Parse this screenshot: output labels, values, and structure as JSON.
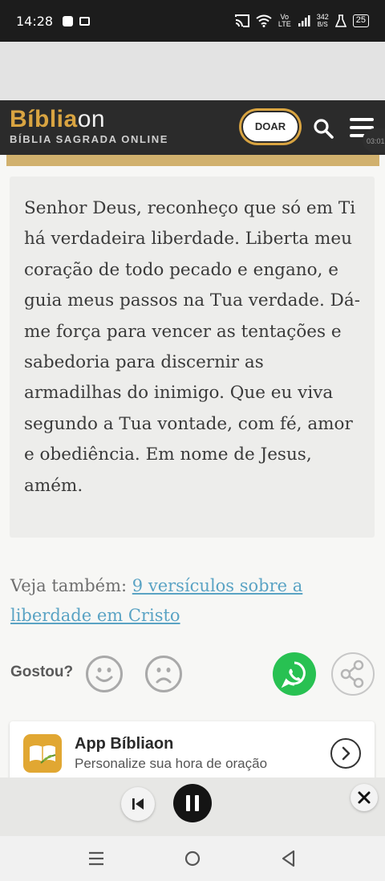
{
  "status_bar": {
    "time": "14:28",
    "network_vo": "Vo",
    "network_lte": "LTE",
    "speed_value": "342",
    "speed_unit": "B/S",
    "battery": "25"
  },
  "header": {
    "logo_main": "Bíblia",
    "logo_on": "on",
    "logo_subtitle": "BÍBLIA SAGRADA ONLINE",
    "donate_label": "DOAR",
    "timer_chip": "03:01"
  },
  "prayer": {
    "text": "Senhor Deus, reconheço que só em Ti há verdadeira liberdade. Liberta meu coração de todo pecado e engano, e guia meus passos na Tua verdade. Dá-me força para vencer as tentações e sabedoria para discernir as armadilhas do inimigo. Que eu viva segundo a Tua vontade, com fé, amor e obediência. Em nome de Jesus, amém."
  },
  "see_also": {
    "label": "Veja também:",
    "link": "9 versículos sobre a liberdade em Cristo"
  },
  "feedback": {
    "label": "Gostou?"
  },
  "app_promo": {
    "title": "App Bíbliaon",
    "subtitle": "Personalize sua hora de oração"
  },
  "colors": {
    "brand_gold": "#d9a441",
    "header_bg": "#2b2b2b",
    "link": "#5aa3c4",
    "whatsapp": "#28c152"
  }
}
